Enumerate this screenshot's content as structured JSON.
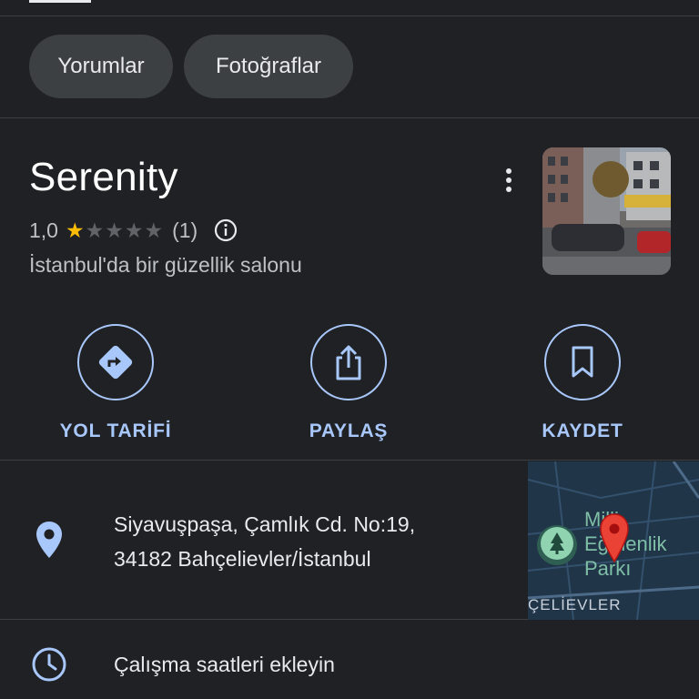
{
  "tabs": {
    "reviews": "Yorumlar",
    "photos": "Fotoğraflar"
  },
  "place": {
    "name": "Serenity",
    "rating": "1,0",
    "rating_value": 1.0,
    "stars_max": 5,
    "review_count": "(1)",
    "category": "İstanbul'da bir güzellik salonu"
  },
  "actions": {
    "directions": "YOL TARİFİ",
    "share": "PAYLAŞ",
    "save": "KAYDET"
  },
  "address": {
    "line1": "Siyavuşpaşa, Çamlık Cd. No:19,",
    "line2": "34182 Bahçelievler/İstanbul"
  },
  "mini_map": {
    "park_label": "Milli\nEğmenlik\nParkı",
    "district_label": "ÇELİEVLER"
  },
  "hours": {
    "label": "Çalışma saatleri ekleyin"
  },
  "colors": {
    "background": "#202124",
    "accent": "#a8c7fa",
    "star_on": "#fbbc04",
    "pin": "#ea4335"
  },
  "icons": {
    "directions": "directions-icon",
    "share": "share-icon",
    "save": "bookmark-icon",
    "location": "location-pin-icon",
    "hours": "clock-icon",
    "info": "info-icon",
    "more": "more-vert-icon"
  }
}
